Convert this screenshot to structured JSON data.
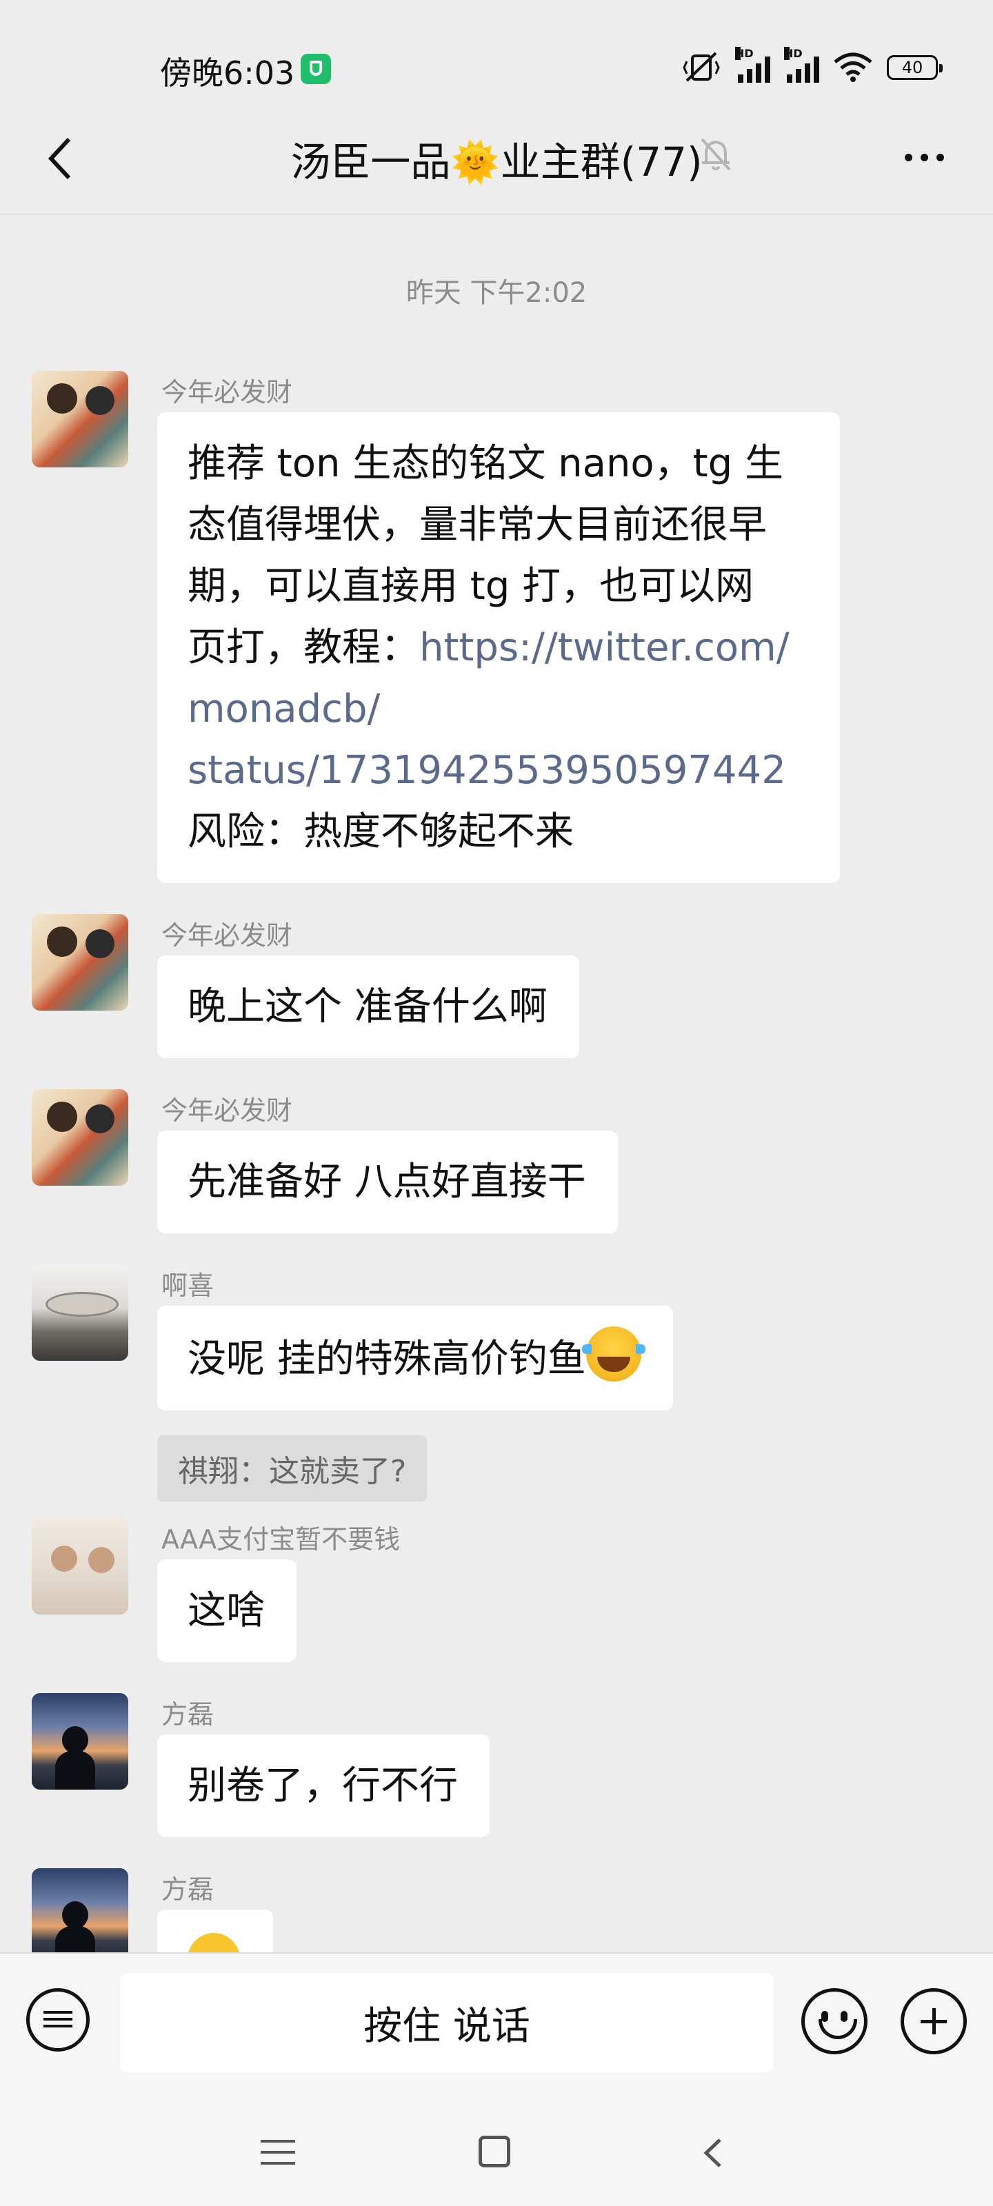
{
  "status_bar": {
    "time": "傍晚6:03",
    "battery": "40",
    "signal_label": "HD"
  },
  "header": {
    "title": "汤臣一品🌞业主群(77)"
  },
  "chat": {
    "timestamp": "昨天 下午2:02",
    "messages": [
      {
        "sender": "今年必发财",
        "lines": [
          "推荐 ton 生态的铭文 nano，tg 生",
          "态值得埋伏，量非常大目前还很早",
          "期，可以直接用 tg 打，也可以网",
          "页打，教程：",
          "https://twitter.com/",
          "monadcb/",
          "status/1731942553950597442",
          "风险：热度不够起不来"
        ]
      },
      {
        "sender": "今年必发财",
        "text": "晚上这个  准备什么啊"
      },
      {
        "sender": "今年必发财",
        "text": "先准备好 八点好直接干"
      },
      {
        "sender": "啊喜",
        "text": "没呢 挂的特殊高价钓鱼",
        "quote": "祺翔：这就卖了?"
      },
      {
        "sender": "AAA支付宝暂不要钱",
        "text": "这啥"
      },
      {
        "sender": "方磊",
        "text": "别卷了，行不行"
      },
      {
        "sender": "方磊",
        "text": ""
      }
    ]
  },
  "input_bar": {
    "voice_label": "按住 说话"
  },
  "icons": {
    "back": "chevron-left-icon",
    "mute": "bell-off-icon",
    "more": "more-dots-icon",
    "keyboard": "keyboard-icon",
    "emoji": "smiley-icon",
    "plus": "plus-circle-icon",
    "sys_menu": "menu-icon",
    "sys_home": "home-square-icon",
    "sys_back": "back-triangle-icon"
  },
  "colors": {
    "link": "#5b6a8c",
    "background": "#ededed",
    "bubble": "#ffffff"
  }
}
